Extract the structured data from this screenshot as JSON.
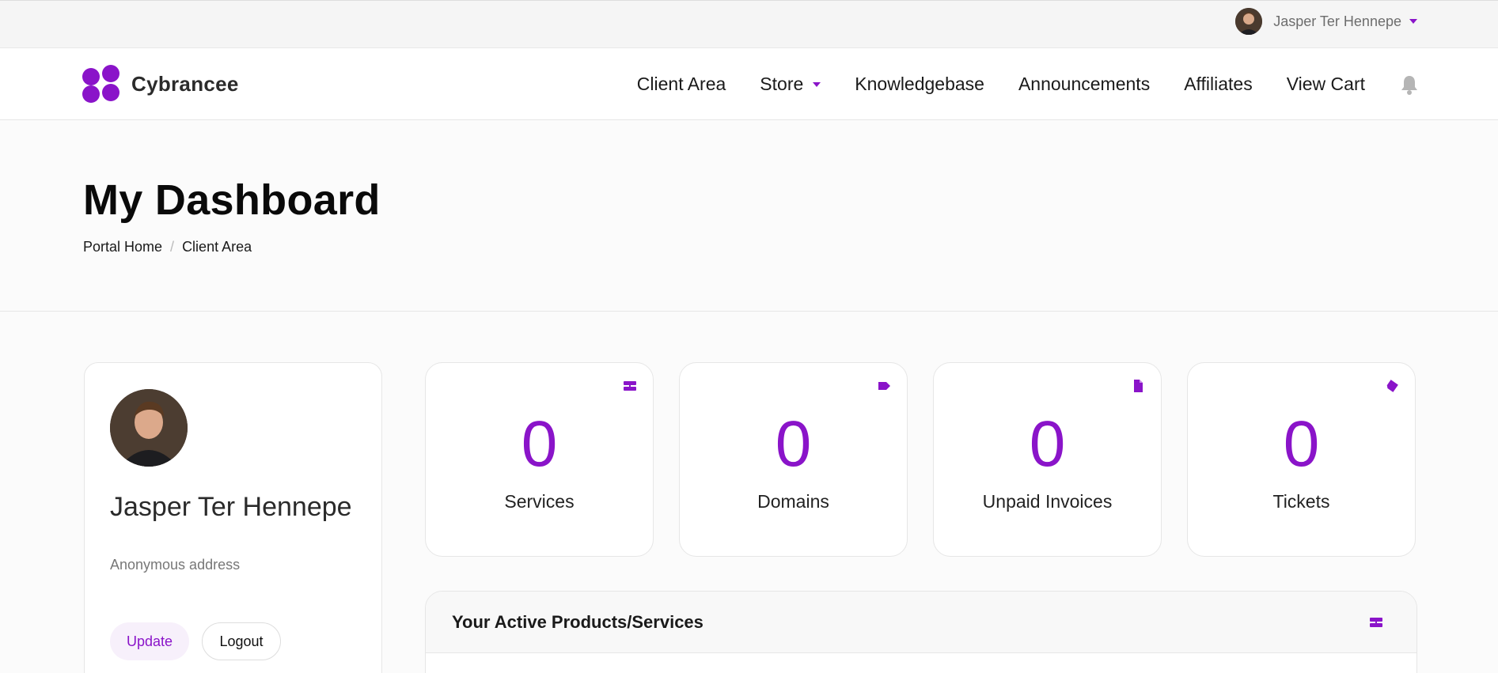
{
  "topbar": {
    "user_name": "Jasper Ter Hennepe"
  },
  "brand": {
    "name": "Cybrancee",
    "accent_color": "#8a14c9"
  },
  "nav": {
    "items": [
      {
        "label": "Client Area"
      },
      {
        "label": "Store",
        "has_dropdown": true
      },
      {
        "label": "Knowledgebase"
      },
      {
        "label": "Announcements"
      },
      {
        "label": "Affiliates"
      },
      {
        "label": "View Cart"
      }
    ],
    "notifications_icon": "bell-icon"
  },
  "header": {
    "title": "My Dashboard",
    "breadcrumb": [
      "Portal Home",
      "Client Area"
    ]
  },
  "profile": {
    "name": "Jasper Ter Hennepe",
    "address": "Anonymous address",
    "update_label": "Update",
    "logout_label": "Logout"
  },
  "stats": [
    {
      "value": "0",
      "label": "Services",
      "icon": "server-icon"
    },
    {
      "value": "0",
      "label": "Domains",
      "icon": "tag-icon"
    },
    {
      "value": "0",
      "label": "Unpaid Invoices",
      "icon": "file-icon"
    },
    {
      "value": "0",
      "label": "Tickets",
      "icon": "ticket-icon"
    }
  ],
  "products_panel": {
    "title": "Your Active Products/Services",
    "icon": "server-icon"
  }
}
